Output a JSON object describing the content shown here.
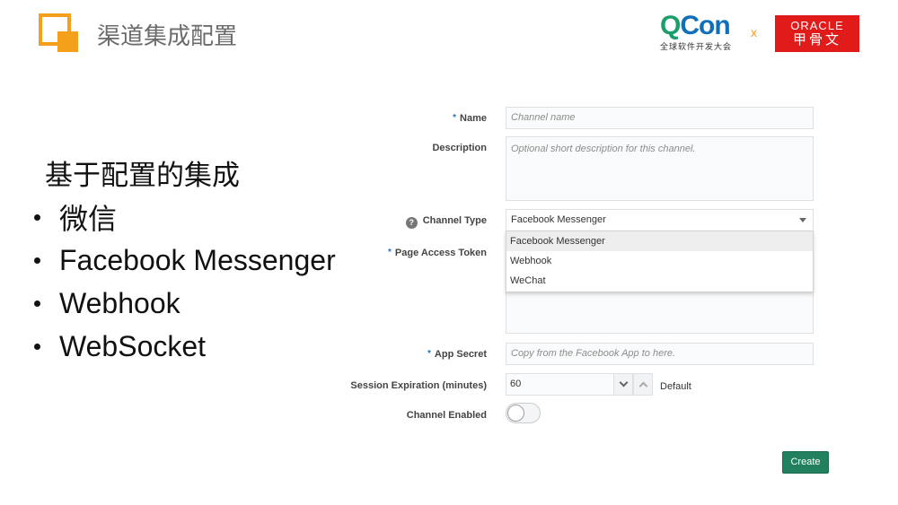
{
  "slide": {
    "title": "渠道集成配置",
    "subtitle": "基于配置的集成",
    "bullets": [
      "微信",
      "Facebook Messenger",
      "Webhook",
      "WebSocket"
    ]
  },
  "logos": {
    "qcon_prefix": "Q",
    "qcon_rest": "Con",
    "qcon_tagline": "全球软件开发大会",
    "separator": "x",
    "oracle_word": "ORACLE",
    "oracle_cn": "甲骨文"
  },
  "form": {
    "name": {
      "label": "Name",
      "placeholder": "Channel name",
      "required_mark": "*"
    },
    "description": {
      "label": "Description",
      "placeholder": "Optional short description for this channel."
    },
    "channel_type": {
      "label": "Channel Type",
      "help_icon": "?",
      "value": "Facebook Messenger",
      "options": [
        "Facebook Messenger",
        "Webhook",
        "WeChat"
      ]
    },
    "page_access_token": {
      "label": "Page Access Token",
      "required_mark": "*"
    },
    "app_secret": {
      "label": "App Secret",
      "placeholder": "Copy from the Facebook App to here.",
      "required_mark": "*"
    },
    "session_expiration": {
      "label": "Session Expiration (minutes)",
      "value": "60",
      "default_label": "Default"
    },
    "channel_enabled": {
      "label": "Channel Enabled",
      "enabled": false
    },
    "create_label": "Create"
  },
  "colors": {
    "accent_orange": "#f5a01a",
    "qcon_green": "#1a9e6a",
    "oracle_red": "#e11a1a",
    "create_green": "#23805e",
    "required_blue": "#2a73c2"
  },
  "icons": {
    "help": "help-icon",
    "select_caret": "caret-down-icon",
    "stepper_down": "chevron-down-icon",
    "stepper_up": "chevron-up-icon"
  }
}
